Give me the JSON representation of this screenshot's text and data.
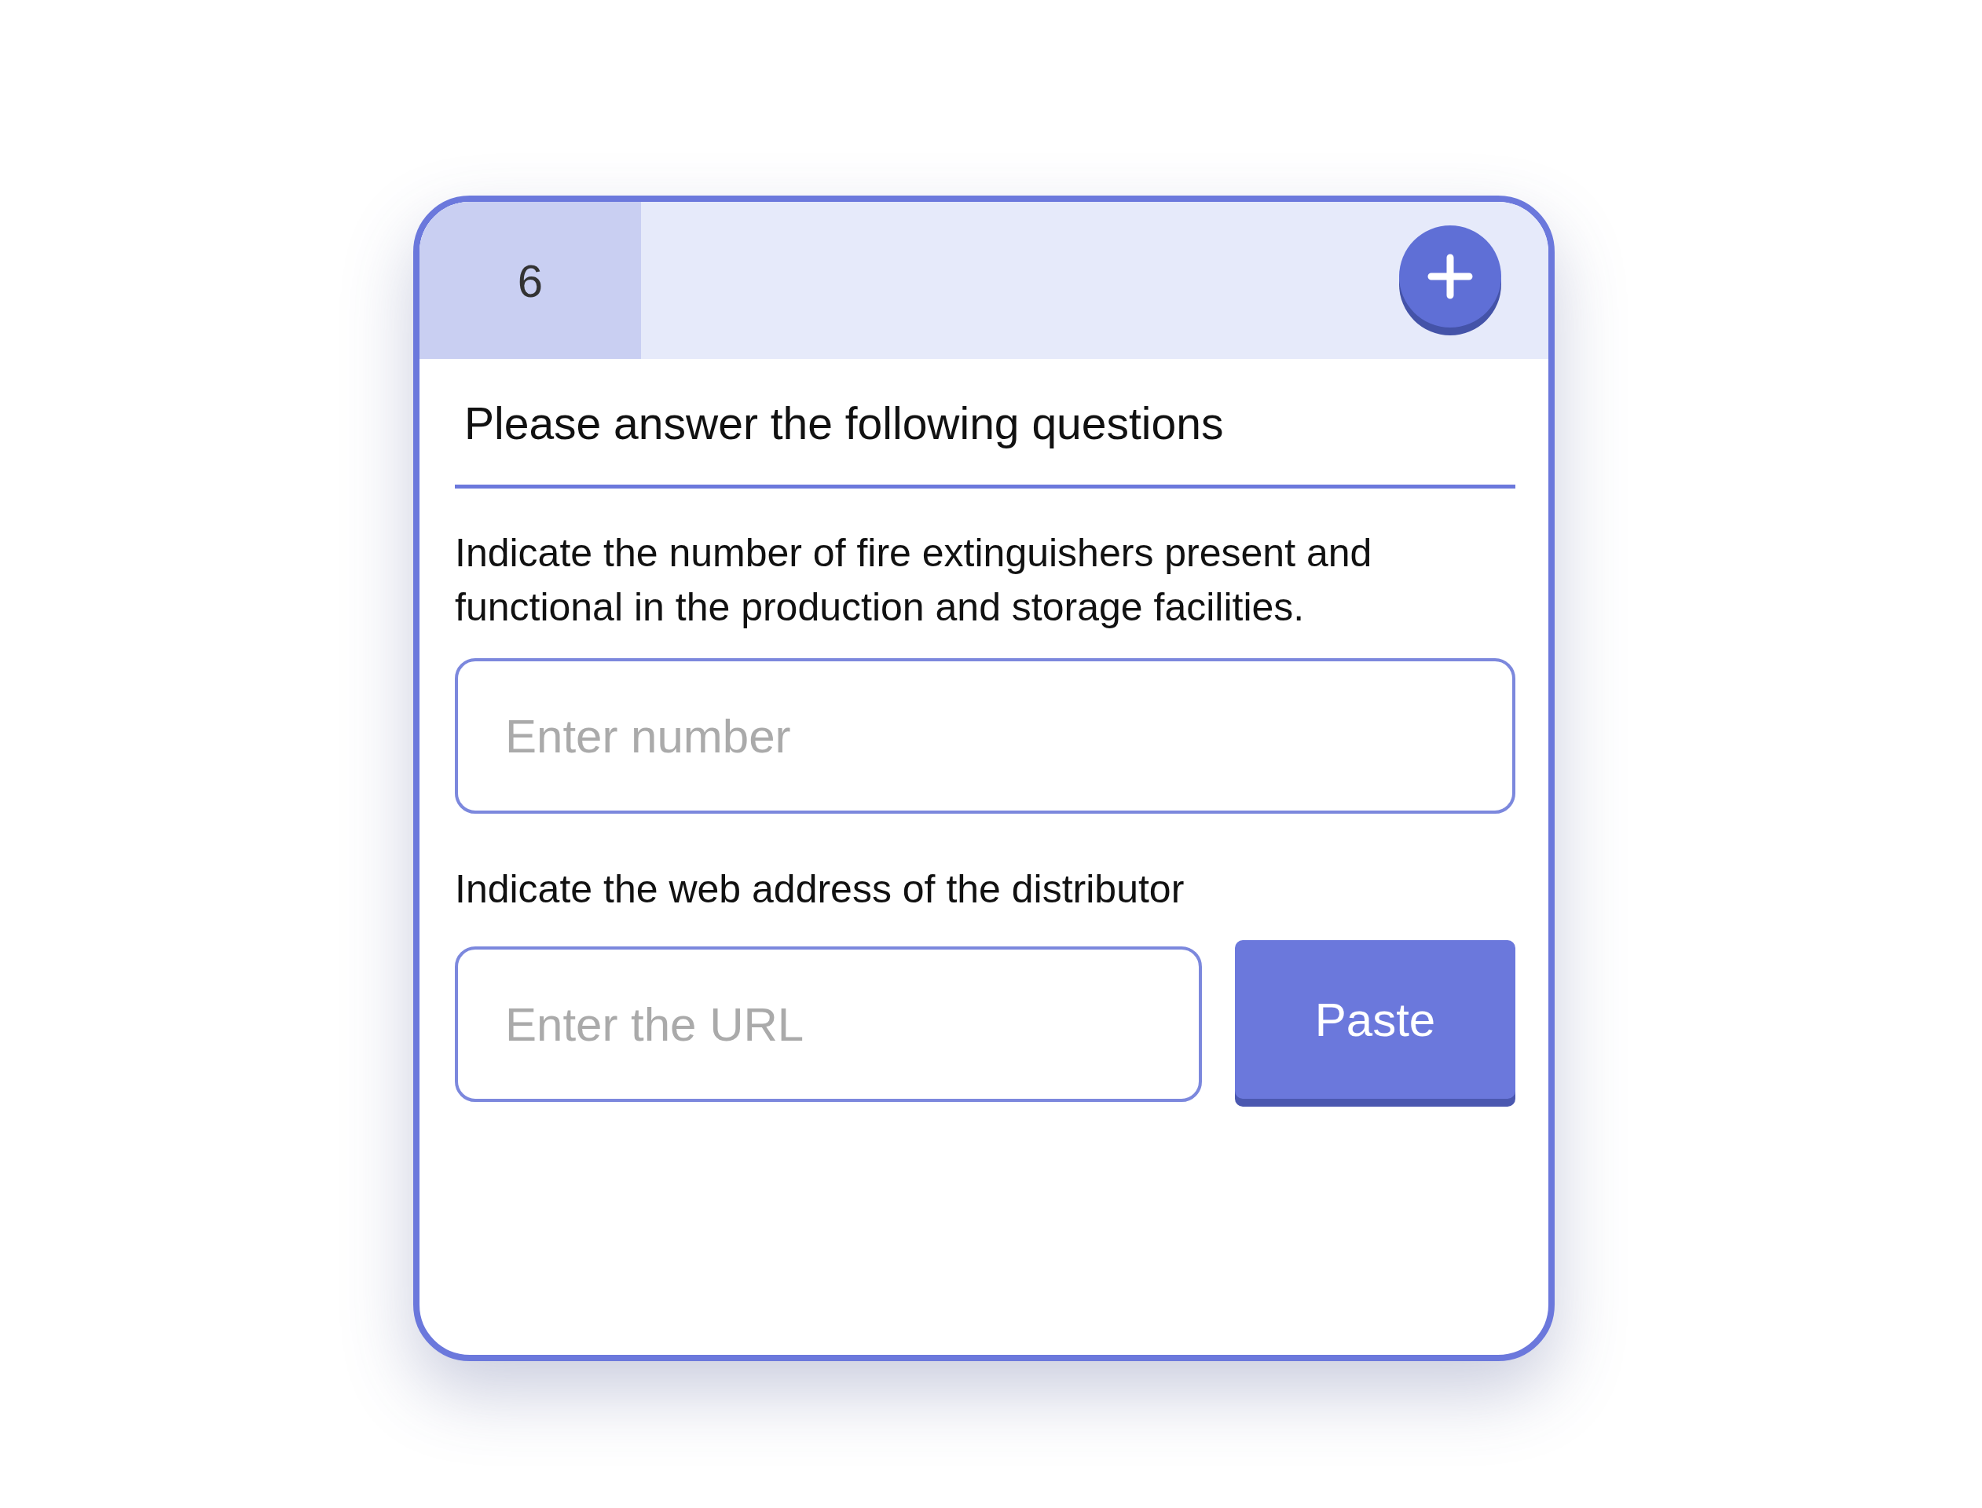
{
  "header": {
    "number": "6"
  },
  "title": "Please answer the following questions",
  "questions": [
    {
      "kind": "number",
      "text": "Indicate the number of fire extinguishers present and functional in the production and storage facilities.",
      "placeholder": "Enter number"
    },
    {
      "kind": "url",
      "text": "Indicate the web address of the distributor",
      "placeholder": "Enter the URL",
      "button": "Paste"
    }
  ]
}
